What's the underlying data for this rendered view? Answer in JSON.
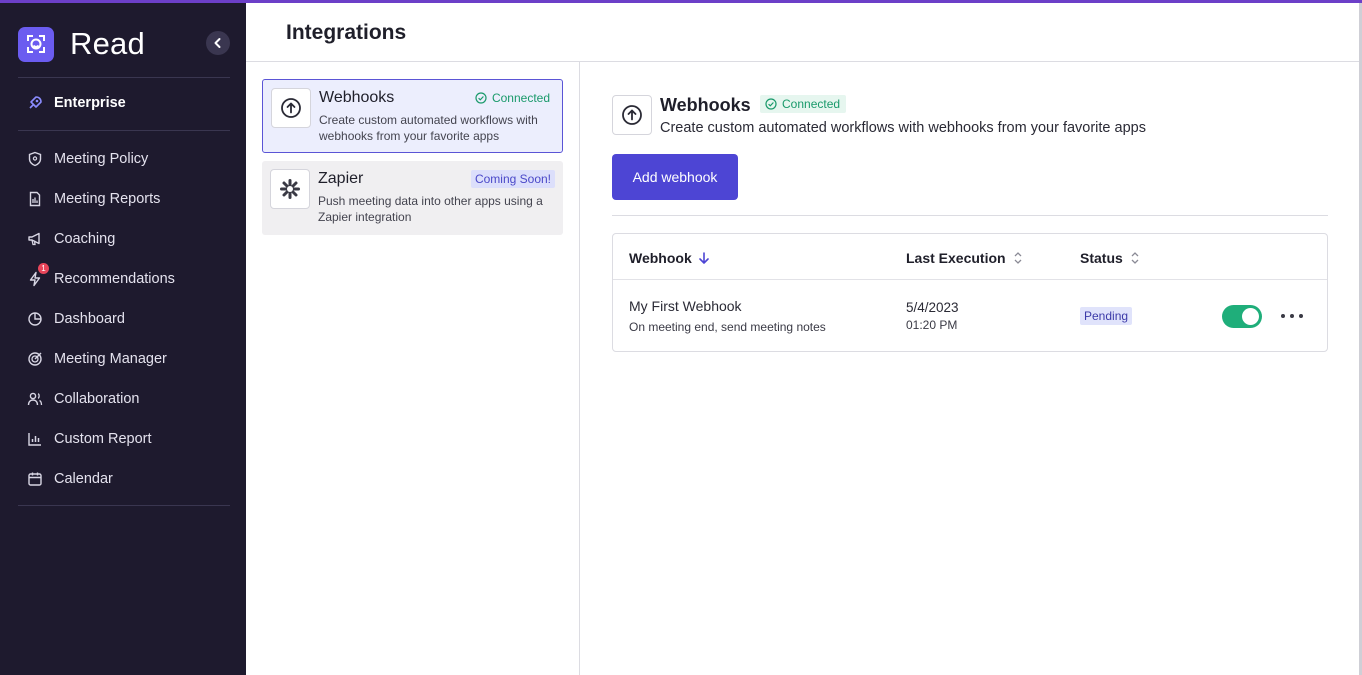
{
  "app": {
    "name": "Read"
  },
  "sidebar": {
    "enterprise_label": "Enterprise",
    "items": [
      {
        "label": "Meeting Policy",
        "icon": "shield-icon"
      },
      {
        "label": "Meeting Reports",
        "icon": "document-icon"
      },
      {
        "label": "Coaching",
        "icon": "megaphone-icon"
      },
      {
        "label": "Recommendations",
        "icon": "lightning-icon",
        "badge": "1"
      },
      {
        "label": "Dashboard",
        "icon": "pie-chart-icon"
      },
      {
        "label": "Meeting Manager",
        "icon": "target-icon"
      },
      {
        "label": "Collaboration",
        "icon": "users-icon"
      },
      {
        "label": "Custom Report",
        "icon": "bar-chart-icon"
      },
      {
        "label": "Calendar",
        "icon": "calendar-icon"
      }
    ]
  },
  "header": {
    "title": "Integrations"
  },
  "integrations": [
    {
      "name": "Webhooks",
      "status": "Connected",
      "description": "Create custom automated workflows with webhooks from your favorite apps"
    },
    {
      "name": "Zapier",
      "status": "Coming Soon!",
      "description": "Push meeting data into other apps using a Zapier integration"
    }
  ],
  "detail": {
    "title": "Webhooks",
    "status": "Connected",
    "description": "Create custom automated workflows with webhooks from your favorite apps",
    "add_button": "Add webhook",
    "table": {
      "columns": [
        "Webhook",
        "Last Execution",
        "Status"
      ],
      "rows": [
        {
          "name": "My First Webhook",
          "subtitle": "On meeting end, send meeting notes",
          "date": "5/4/2023",
          "time": "01:20 PM",
          "status": "Pending",
          "enabled": true
        }
      ]
    }
  },
  "colors": {
    "accent": "#4d45d4",
    "sidebar_bg": "#1e1a2e",
    "success": "#1fae7a"
  }
}
